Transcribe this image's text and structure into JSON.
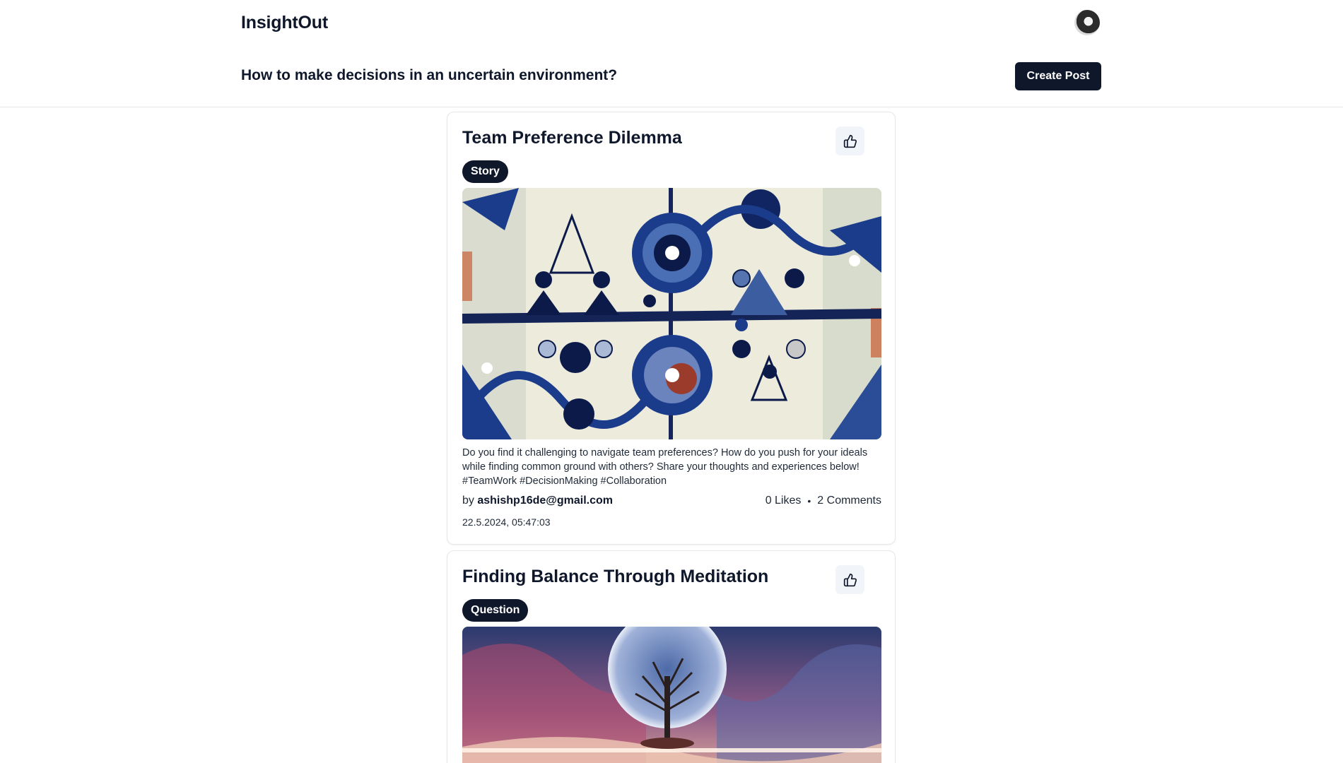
{
  "header": {
    "brand": "InsightOut",
    "question": "How to make decisions in an uncertain environment?",
    "create_post_label": "Create Post"
  },
  "posts": [
    {
      "title": "Team Preference Dilemma",
      "tag": "Story",
      "body": "Do you find it challenging to navigate team preferences? How do you push for your ideals while finding common ground with others? Share your thoughts and experiences below! #TeamWork #DecisionMaking #Collaboration",
      "by_label": "by",
      "author": "ashishp16de@gmail.com",
      "likes": "0 Likes",
      "separator": "•",
      "comments": "2 Comments",
      "timestamp": "22.5.2024, 05:47:03"
    },
    {
      "title": "Finding Balance Through Meditation",
      "tag": "Question"
    }
  ],
  "colors": {
    "primary": "#0f172a",
    "border": "#e5e7eb",
    "like_bg": "#f1f5f9"
  },
  "icons": {
    "like": "thumbs-up-icon"
  }
}
